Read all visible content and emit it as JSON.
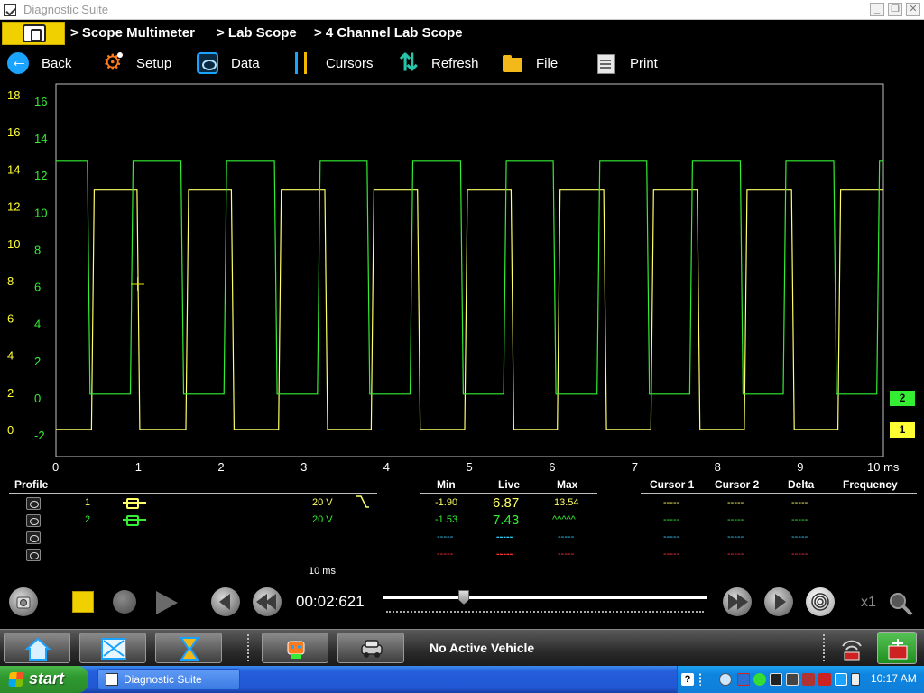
{
  "window": {
    "title": "Diagnostic Suite",
    "minimize": "_",
    "restore": "❐",
    "close": "✕"
  },
  "breadcrumb": [
    "> Scope Multimeter",
    "> Lab Scope",
    "> 4 Channel Lab Scope"
  ],
  "toolbar": {
    "back": "Back",
    "setup": "Setup",
    "data": "Data",
    "cursors": "Cursors",
    "refresh": "Refresh",
    "file": "File",
    "print": "Print"
  },
  "colors": {
    "channel1": "#ffff66",
    "channel2": "#33ee33",
    "channel3": "#33ccff",
    "channel4": "#ff3333",
    "accent": "#f1d000"
  },
  "chart_data": {
    "type": "line",
    "time_ticks": [
      "0",
      "1",
      "2",
      "3",
      "4",
      "5",
      "6",
      "7",
      "8",
      "9",
      "10 ms"
    ],
    "y_ticks_channel1": [
      "18",
      "16",
      "14",
      "12",
      "10",
      "8",
      "6",
      "4",
      "2",
      "0"
    ],
    "y_ticks_channel2": [
      "16",
      "14",
      "12",
      "10",
      "8",
      "6",
      "4",
      "2",
      "0",
      "-2"
    ],
    "xlim": [
      0,
      10
    ],
    "grid": false,
    "series": [
      {
        "name": "1",
        "type": "square",
        "low": -1.7,
        "high": 11.2,
        "rise_times": [
          0.43,
          1.57,
          2.69,
          3.81,
          4.94,
          6.06,
          7.19,
          8.32,
          9.45
        ],
        "fall_times": [
          0.98,
          2.12,
          3.25,
          4.37,
          5.5,
          6.62,
          7.75,
          8.89
        ]
      },
      {
        "name": "2",
        "type": "square",
        "low": 0.2,
        "high": 12.8,
        "rise_times": [
          0.9,
          2.03,
          3.16,
          4.28,
          5.41,
          6.54,
          7.66,
          8.79,
          9.92
        ],
        "fall_times": [
          0.38,
          1.51,
          2.64,
          3.76,
          4.89,
          6.01,
          7.14,
          8.27,
          9.4
        ]
      }
    ],
    "channel_markers": [
      "2",
      "1"
    ]
  },
  "panel": {
    "headers": {
      "profile": "Profile",
      "min": "Min",
      "live": "Live",
      "max": "Max",
      "cursor1": "Cursor 1",
      "cursor2": "Cursor 2",
      "delta": "Delta",
      "frequency": "Frequency"
    },
    "rows": [
      {
        "channel": "1",
        "scale": "20 V",
        "min": "-1.90",
        "live": "6.87",
        "max": "13.54",
        "c1": "-----",
        "c2": "-----",
        "delta": "-----"
      },
      {
        "channel": "2",
        "scale": "20 V",
        "min": "-1.53",
        "live": "7.43",
        "max": "^^^^^",
        "c1": "-----",
        "c2": "-----",
        "delta": "-----"
      },
      {
        "channel": "",
        "scale": "",
        "min": "-----",
        "live": "-----",
        "max": "-----",
        "c1": "-----",
        "c2": "-----",
        "delta": "-----"
      },
      {
        "channel": "",
        "scale": "",
        "min": "-----",
        "live": "-----",
        "max": "-----",
        "c1": "-----",
        "c2": "-----",
        "delta": "-----"
      }
    ],
    "timebase": "10 ms"
  },
  "playback": {
    "time": "00:02:621",
    "zoom": "x1",
    "position": 0.25
  },
  "dock": {
    "vehicle_status": "No Active Vehicle"
  },
  "taskbar": {
    "start": "start",
    "task": "Diagnostic Suite",
    "clock": "10:17 AM"
  }
}
